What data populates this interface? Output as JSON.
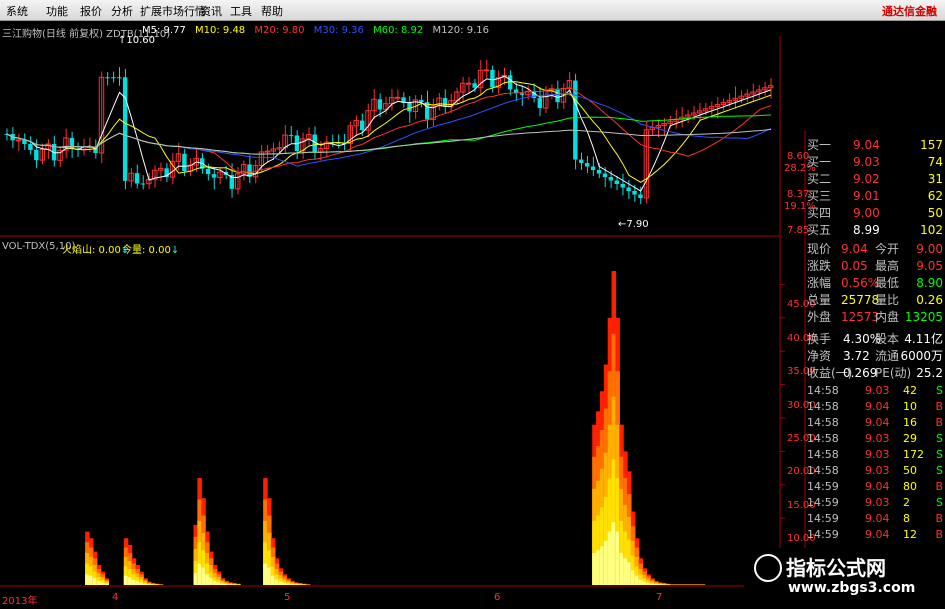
{
  "menu": {
    "items": [
      "系统",
      "功能",
      "报价",
      "分析",
      "扩展市场行情",
      "资讯",
      "工具",
      "帮助"
    ],
    "brand": "通达信金融"
  },
  "chart_header": {
    "title": "三江购物(日线 前复权) ZDTB(11,10)",
    "ma": [
      {
        "label": "M5: 9.77",
        "color": "#ffffff"
      },
      {
        "label": "M10: 9.48",
        "color": "#ffff00"
      },
      {
        "label": "M20: 9.80",
        "color": "#ff3030"
      },
      {
        "label": "M30: 9.36",
        "color": "#3050ff"
      },
      {
        "label": "M60: 8.92",
        "color": "#00ff00"
      },
      {
        "label": "M120: 9.16",
        "color": "#c0c0c0"
      }
    ],
    "high_label": "10.60",
    "low_label": "7.90",
    "arrow_up": "↑",
    "arrow_dn": "↓"
  },
  "price_axis": [
    "8.60",
    "28.2%",
    "8.37",
    "19.1%",
    "7.85"
  ],
  "vol_header": {
    "title": "VOL-TDX(5,10)",
    "huoyanshan": "火焰山: 0.00",
    "jinliang": "今量: 0.00"
  },
  "vol_axis": [
    "45.00",
    "40.00",
    "35.00",
    "30.00",
    "25.00",
    "20.00",
    "15.00",
    "10.00",
    "5.00"
  ],
  "x_axis": [
    "2013年",
    "4",
    "5",
    "6",
    "7"
  ],
  "chart_data": {
    "type": "bar",
    "title": "VOL-TDX(5,10)",
    "series": [
      {
        "name": "火焰山",
        "values": [
          0,
          0,
          0,
          0,
          0,
          0,
          0,
          0,
          0,
          0,
          0,
          0,
          0,
          0,
          0,
          0,
          0,
          0,
          0,
          0,
          0,
          0,
          8.0,
          7.0,
          5.0,
          3.0,
          2.0,
          1.0,
          0,
          0,
          0,
          0,
          7.0,
          6.0,
          4.0,
          3.0,
          2.0,
          1.0,
          0.5,
          0.3,
          0.2,
          0.1,
          0,
          0,
          0,
          0,
          0,
          0,
          0,
          0,
          9.0,
          16.0,
          13.0,
          8.0,
          5.0,
          3.0,
          2.0,
          1.0,
          0.6,
          0.4,
          0.3,
          0.2,
          0,
          0,
          0,
          0,
          0,
          0,
          16.0,
          13.0,
          7.0,
          4.0,
          2.5,
          1.6,
          1.0,
          0.6,
          0.4,
          0.3,
          0.2,
          0.1,
          0,
          0,
          0,
          0,
          0,
          0,
          0,
          0,
          0,
          0,
          0,
          0,
          0,
          0,
          0,
          0,
          0,
          0,
          0,
          0,
          0,
          0,
          0,
          0,
          0,
          0,
          0,
          0,
          0,
          0,
          0,
          0,
          0,
          0,
          0,
          0,
          0,
          0,
          0,
          0,
          0,
          0,
          0,
          0,
          0,
          0,
          0,
          0,
          0,
          0,
          0,
          0,
          0,
          0,
          0,
          0,
          0,
          0,
          0,
          0,
          0,
          0,
          0,
          0,
          0,
          0,
          0,
          0,
          0,
          0,
          0,
          0,
          0,
          24.0,
          26.0,
          29.0,
          33.0,
          40.0,
          47.0,
          40.0,
          24.0,
          20.0,
          17.0,
          11.0,
          7.0,
          4.0,
          2.5,
          1.6,
          1.0,
          0.6,
          0.4,
          0.3,
          0.2,
          0.1,
          0.1,
          0.1,
          0.1,
          0.1,
          0.1,
          0.1,
          0.1,
          0.1,
          0,
          0,
          0,
          0,
          0,
          0,
          0,
          0,
          0,
          0,
          0,
          0,
          0,
          0,
          0,
          0,
          0,
          0,
          0
        ]
      }
    ],
    "ylim": [
      0,
      50
    ],
    "ticks": [
      5,
      10,
      15,
      20,
      25,
      30,
      35,
      40,
      45
    ],
    "colors": [
      "#ffff80",
      "#ffe000",
      "#ffb000",
      "#ff7000",
      "#ff2000"
    ]
  },
  "quote_panel": {
    "bids": [
      {
        "label": "买一",
        "price": "9.04",
        "vol": "157"
      },
      {
        "label": "买一",
        "price": "9.03",
        "vol": "74"
      },
      {
        "label": "买二",
        "price": "9.02",
        "vol": "31"
      },
      {
        "label": "买三",
        "price": "9.01",
        "vol": "62"
      },
      {
        "label": "买四",
        "price": "9.00",
        "vol": "50"
      },
      {
        "label": "买五",
        "price": "8.99",
        "vol": "102"
      }
    ],
    "stats": [
      {
        "l1": "现价",
        "v1": "9.04",
        "l2": "今开",
        "v2": "9.00",
        "c1": "#ff3030",
        "c2": "#ff3030"
      },
      {
        "l1": "涨跌",
        "v1": "0.05",
        "l2": "最高",
        "v2": "9.05",
        "c1": "#ff3030",
        "c2": "#ff3030"
      },
      {
        "l1": "涨幅",
        "v1": "0.56%",
        "l2": "最低",
        "v2": "8.90",
        "c1": "#ff3030",
        "c2": "#00ff00"
      },
      {
        "l1": "总量",
        "v1": "25778",
        "l2": "量比",
        "v2": "0.26",
        "c1": "#ffff00",
        "c2": "#ffff00"
      },
      {
        "l1": "外盘",
        "v1": "12573",
        "l2": "内盘",
        "v2": "13205",
        "c1": "#ff3030",
        "c2": "#00ff00"
      }
    ],
    "fund": [
      {
        "l1": "换手",
        "v1": "4.30%",
        "l2": "股本",
        "v2": "4.11亿"
      },
      {
        "l1": "净资",
        "v1": "3.72",
        "l2": "流通",
        "v2": "6000万"
      },
      {
        "l1": "收益(一)",
        "v1": "0.269",
        "l2": "PE(动)",
        "v2": "25.2"
      }
    ],
    "ticks": [
      {
        "t": "14:58",
        "p": "9.03",
        "v": "42",
        "s": "S"
      },
      {
        "t": "14:58",
        "p": "9.04",
        "v": "10",
        "s": "B"
      },
      {
        "t": "14:58",
        "p": "9.04",
        "v": "16",
        "s": "B"
      },
      {
        "t": "14:58",
        "p": "9.03",
        "v": "29",
        "s": "S"
      },
      {
        "t": "14:58",
        "p": "9.03",
        "v": "172",
        "s": "S"
      },
      {
        "t": "14:58",
        "p": "9.03",
        "v": "50",
        "s": "S"
      },
      {
        "t": "14:59",
        "p": "9.04",
        "v": "80",
        "s": "B"
      },
      {
        "t": "14:59",
        "p": "9.03",
        "v": "2",
        "s": "S"
      },
      {
        "t": "14:59",
        "p": "9.04",
        "v": "8",
        "s": "B"
      },
      {
        "t": "14:59",
        "p": "9.04",
        "v": "12",
        "s": "B"
      }
    ]
  },
  "watermark": {
    "title": "指标公式网",
    "url": "www.zbgs3.com"
  }
}
